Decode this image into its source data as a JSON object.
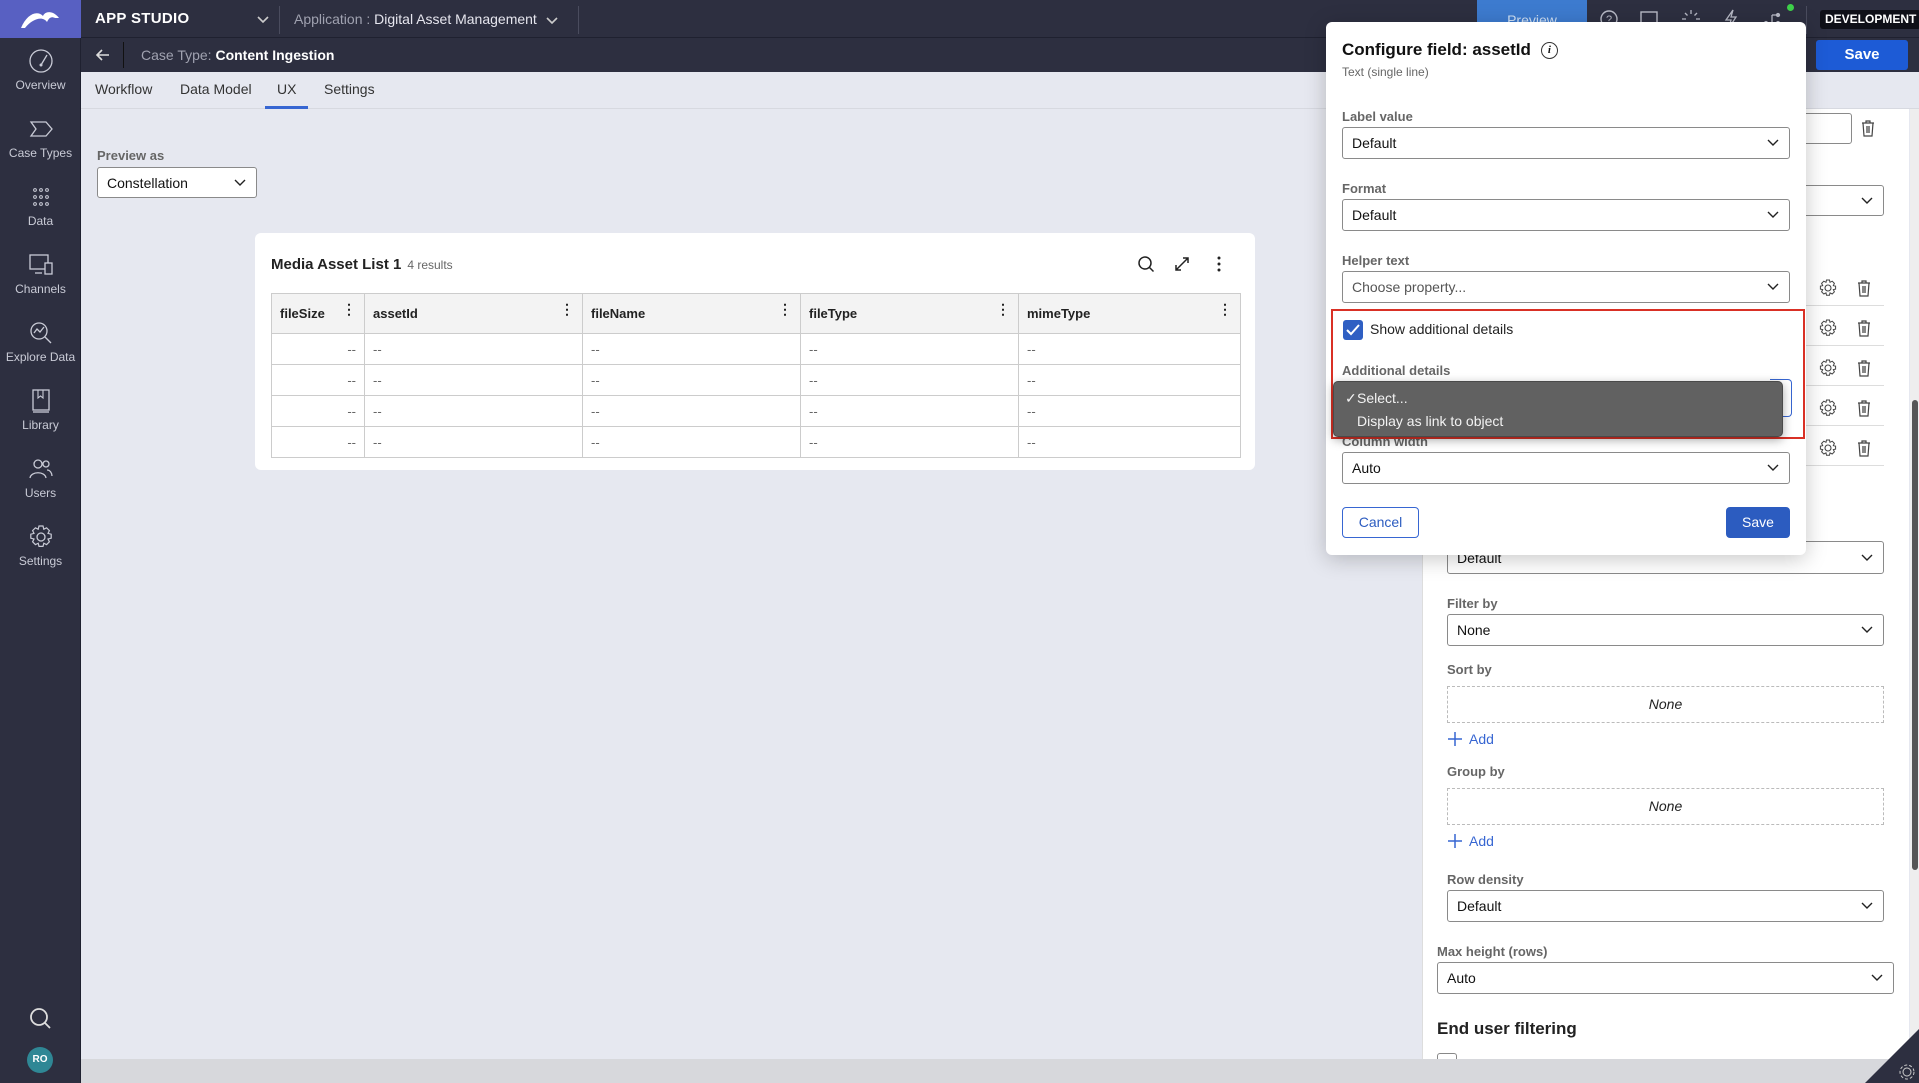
{
  "topbar": {
    "studio_label": "APP STUDIO",
    "application_label": "Application :",
    "application_name": "Digital Asset Management",
    "preview_label": "Preview",
    "environment_badge": "DEVELOPMENT",
    "save_label": "Save",
    "icons": [
      "help-icon",
      "window-icon",
      "loading-icon",
      "lightning-icon",
      "branch-icon"
    ]
  },
  "subbar": {
    "case_type_label": "Case Type:",
    "case_type_name": "Content Ingestion"
  },
  "sidebar": {
    "items": [
      {
        "label": "Overview",
        "icon": "dashboard-icon"
      },
      {
        "label": "Case Types",
        "icon": "chevron-shape-icon"
      },
      {
        "label": "Data",
        "icon": "grid-dots-icon"
      },
      {
        "label": "Channels",
        "icon": "devices-icon"
      },
      {
        "label": "Explore Data",
        "icon": "chart-search-icon"
      },
      {
        "label": "Library",
        "icon": "book-icon"
      },
      {
        "label": "Users",
        "icon": "users-icon"
      },
      {
        "label": "Settings",
        "icon": "gear-icon"
      }
    ],
    "avatar_initials": "RO"
  },
  "tabs": [
    {
      "label": "Workflow",
      "active": false
    },
    {
      "label": "Data Model",
      "active": false
    },
    {
      "label": "UX",
      "active": true
    },
    {
      "label": "Settings",
      "active": false
    }
  ],
  "preview": {
    "label": "Preview as",
    "value": "Constellation"
  },
  "list": {
    "title": "Media Asset List 1",
    "count": "4 results",
    "columns": [
      "fileSize",
      "assetId",
      "fileName",
      "fileType",
      "mimeType"
    ],
    "rows": [
      [
        "--",
        "--",
        "--",
        "--",
        "--"
      ],
      [
        "--",
        "--",
        "--",
        "--",
        "--"
      ],
      [
        "--",
        "--",
        "--",
        "--",
        "--"
      ],
      [
        "--",
        "--",
        "--",
        "--",
        "--"
      ]
    ]
  },
  "right_panel": {
    "default_select": "Default",
    "filter_by_label": "Filter by",
    "filter_by_value": "None",
    "sort_by_label": "Sort by",
    "sort_by_value": "None",
    "add_label": "Add",
    "group_by_label": "Group by",
    "group_by_value": "None",
    "row_density_label": "Row density",
    "row_density_value": "Default",
    "max_height_label": "Max height (rows)",
    "max_height_value": "Auto",
    "end_user_filtering": "End user filtering"
  },
  "modal": {
    "title": "Configure field: assetId",
    "subtitle": "Text (single line)",
    "label_value_label": "Label value",
    "label_value": "Default",
    "format_label": "Format",
    "format_value": "Default",
    "helper_text_label": "Helper text",
    "helper_text_placeholder": "Choose property...",
    "show_details_label": "Show additional details",
    "show_details_checked": true,
    "additional_details_label": "Additional details",
    "dropdown_options": [
      {
        "label": "Select...",
        "selected": true
      },
      {
        "label": "Display as link to object",
        "selected": false
      }
    ],
    "column_width_label": "Column width",
    "column_width_value": "Auto",
    "cancel_label": "Cancel",
    "save_label": "Save"
  },
  "colors": {
    "accent": "#2c5cc0",
    "nav_bg": "#2d2f40",
    "logo_bg": "#5860c2",
    "highlight": "#d93025"
  }
}
